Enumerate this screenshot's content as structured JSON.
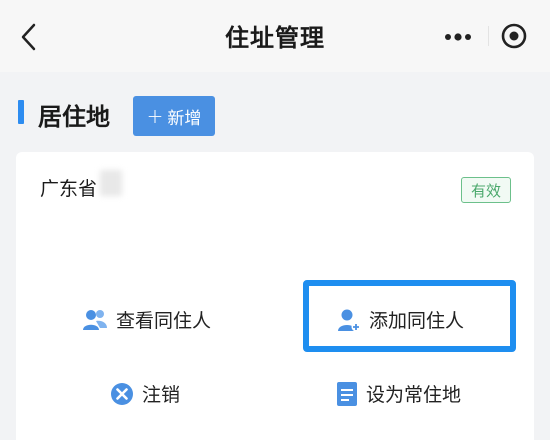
{
  "navbar": {
    "title": "住址管理",
    "back_icon": "chevron-left-icon",
    "more_icon": "more-dots-icon",
    "close_icon": "target-circle-icon"
  },
  "section": {
    "title": "居住地",
    "add_button_label": "新增"
  },
  "residence": {
    "address": "广东省",
    "status": "有效"
  },
  "actions": {
    "view_cohabitants": "查看同住人",
    "add_cohabitant": "添加同住人",
    "cancel": "注销",
    "set_permanent": "设为常住地"
  },
  "colors": {
    "accent": "#4a90e2",
    "highlight_border": "#1e8ef0",
    "status_green": "#4aa86c"
  }
}
